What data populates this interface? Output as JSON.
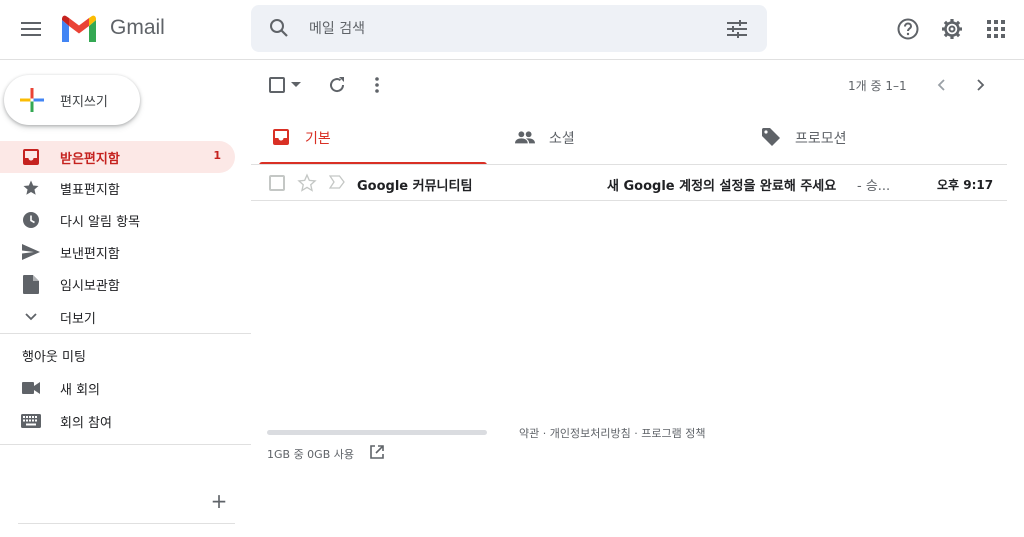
{
  "header": {
    "app_name": "Gmail",
    "search": {
      "placeholder": "메일 검색",
      "value": ""
    }
  },
  "sidebar": {
    "compose_label": "편지쓰기",
    "items": [
      {
        "label": "받은편지함",
        "count": "1",
        "icon": "inbox-icon"
      },
      {
        "label": "별표편지함",
        "icon": "star-icon"
      },
      {
        "label": "다시 알림 항목",
        "icon": "clock-icon"
      },
      {
        "label": "보낸편지함",
        "icon": "send-icon"
      },
      {
        "label": "임시보관함",
        "icon": "draft-icon"
      },
      {
        "label": "더보기",
        "icon": "chevron-down-icon"
      }
    ],
    "meet": {
      "title": "행아웃 미팅",
      "items": [
        {
          "label": "새 회의",
          "icon": "video-camera-icon"
        },
        {
          "label": "회의 참여",
          "icon": "keyboard-icon"
        }
      ]
    },
    "add_label": "+"
  },
  "toolbar": {
    "page_count": "1개 중 1–1"
  },
  "tabs": [
    {
      "label": "기본",
      "icon": "inbox-icon"
    },
    {
      "label": "소셜",
      "icon": "people-icon"
    },
    {
      "label": "프로모션",
      "icon": "tag-icon"
    }
  ],
  "emails": [
    {
      "sender": "Google 커뮤니티팀",
      "subject": "새 Google 계정의 설정을 완료해 주세요",
      "snippet": " - 승...",
      "time": "오후 9:17"
    }
  ],
  "footer": {
    "storage_text": "1GB 중 0GB 사용",
    "storage_fraction": 0,
    "links": [
      "약관",
      "개인정보처리방침",
      "프로그램 정책"
    ]
  },
  "colors": {
    "accent_red": "#d93025",
    "active_bg": "#fce8e6",
    "search_bg": "#eef1f6"
  }
}
